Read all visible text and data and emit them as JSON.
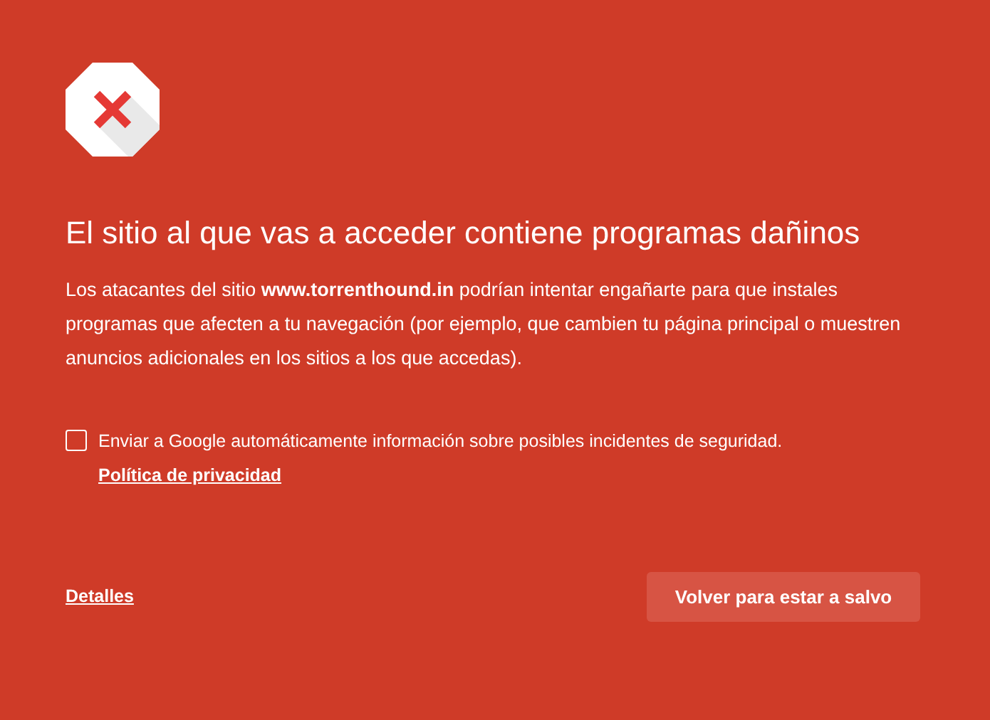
{
  "heading": "El sitio al que vas a acceder contiene programas dañinos",
  "body": "Los atacantes del sitio **www.torrenthound.in** podrían intentar engañarte para que instales programas que afecten a tu navegación (por ejemplo, que cambien tu página principal o muestren anuncios adicionales en los sitios a los que accedas).",
  "report": {
    "checked": false,
    "label": "Enviar a Google automáticamente información sobre posibles incidentes de seguridad.",
    "link": "Política de privacidad"
  },
  "details_link": "Detalles",
  "primary_button": "Volver para estar a salvo"
}
